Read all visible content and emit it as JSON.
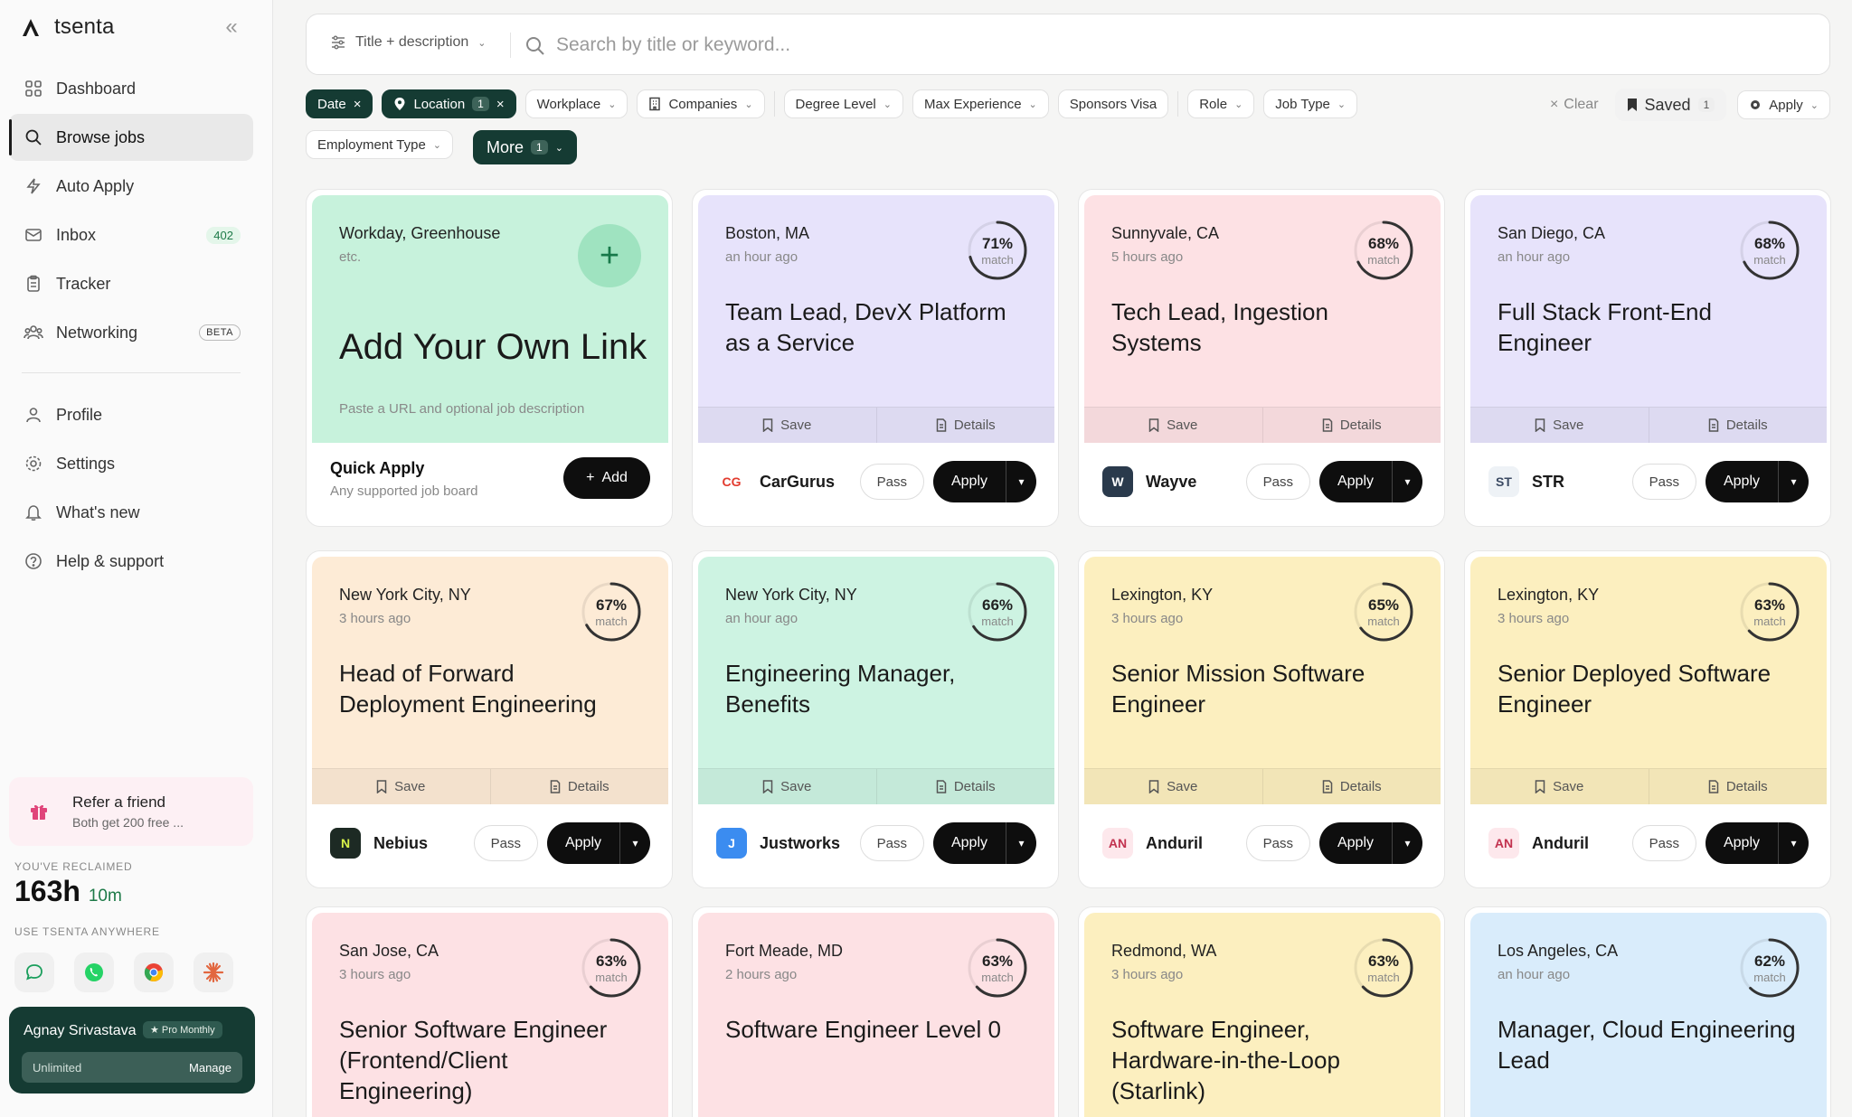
{
  "brand": {
    "name": "tsenta"
  },
  "nav": {
    "items": [
      {
        "label": "Dashboard"
      },
      {
        "label": "Browse jobs"
      },
      {
        "label": "Auto Apply"
      },
      {
        "label": "Inbox",
        "badge": "402"
      },
      {
        "label": "Tracker"
      },
      {
        "label": "Networking",
        "tag": "BETA"
      },
      {
        "label": "Profile"
      },
      {
        "label": "Settings"
      },
      {
        "label": "What's new"
      },
      {
        "label": "Help & support"
      }
    ]
  },
  "refer": {
    "title": "Refer a friend",
    "subtitle": "Both get 200 free ..."
  },
  "reclaimed": {
    "label": "YOU'VE RECLAIMED",
    "hours": "163h",
    "minutes": "10m"
  },
  "anywhere": {
    "label": "USE TSENTA ANYWHERE"
  },
  "user": {
    "name": "Agnay Srivastava",
    "plan": "Pro Monthly",
    "usage": "Unlimited",
    "manage": "Manage"
  },
  "search": {
    "mode": "Title + description",
    "placeholder": "Search by title or keyword..."
  },
  "filters": {
    "date": "Date",
    "location": "Location",
    "location_count": "1",
    "workplace": "Workplace",
    "companies": "Companies",
    "degree": "Degree Level",
    "experience": "Max Experience",
    "visa": "Sponsors Visa",
    "role": "Role",
    "jobtype": "Job Type",
    "employment": "Employment Type",
    "more": "More",
    "more_count": "1",
    "clear": "Clear",
    "saved": "Saved",
    "saved_count": "1",
    "apply": "Apply"
  },
  "quick_add": {
    "sources": "Workday, Greenhouse",
    "etc": "etc.",
    "title": "Add Your Own Link",
    "hint": "Paste a URL and optional job description",
    "qa_title": "Quick Apply",
    "qa_sub": "Any supported job board",
    "add": "Add"
  },
  "labels": {
    "save": "Save",
    "details": "Details",
    "pass": "Pass",
    "apply": "Apply",
    "match": "match"
  },
  "jobs": [
    {
      "location": "Boston, MA",
      "posted": "an hour ago",
      "match": "71%",
      "match_value": 0.71,
      "title": "Team Lead, DevX Platform as a Service",
      "company": "CarGurus",
      "logo": "CG",
      "bg": "#e7e3fb",
      "logo_bg": "#ffffff",
      "logo_fg": "#e23b2e"
    },
    {
      "location": "Sunnyvale, CA",
      "posted": "5 hours ago",
      "match": "68%",
      "match_value": 0.68,
      "title": "Tech Lead, Ingestion Systems",
      "company": "Wayve",
      "logo": "W",
      "bg": "#fde1e4",
      "logo_bg": "#2a3a4c",
      "logo_fg": "#ffffff"
    },
    {
      "location": "San Diego, CA",
      "posted": "an hour ago",
      "match": "68%",
      "match_value": 0.68,
      "title": "Full Stack Front-End Engineer",
      "company": "STR",
      "logo": "ST",
      "bg": "#e7e3fb",
      "logo_bg": "#eef2f6",
      "logo_fg": "#3b4a63"
    },
    {
      "location": "New York City, NY",
      "posted": "3 hours ago",
      "match": "67%",
      "match_value": 0.67,
      "title": "Head of Forward Deployment Engineering",
      "company": "Nebius",
      "logo": "N",
      "bg": "#fdebd6",
      "logo_bg": "#1d2a24",
      "logo_fg": "#d8f24a"
    },
    {
      "location": "New York City, NY",
      "posted": "an hour ago",
      "match": "66%",
      "match_value": 0.66,
      "title": "Engineering Manager, Benefits",
      "company": "Justworks",
      "logo": "J",
      "bg": "#cdf3e2",
      "logo_bg": "#3b8cf0",
      "logo_fg": "#ffffff"
    },
    {
      "location": "Lexington, KY",
      "posted": "3 hours ago",
      "match": "65%",
      "match_value": 0.65,
      "title": "Senior Mission Software Engineer",
      "company": "Anduril",
      "logo": "AN",
      "bg": "#fcefbf",
      "logo_bg": "#fde8ec",
      "logo_fg": "#c2324f"
    },
    {
      "location": "Lexington, KY",
      "posted": "3 hours ago",
      "match": "63%",
      "match_value": 0.63,
      "title": "Senior Deployed Software Engineer",
      "company": "Anduril",
      "logo": "AN",
      "bg": "#fcefbf",
      "logo_bg": "#fde8ec",
      "logo_fg": "#c2324f"
    },
    {
      "location": "San Jose, CA",
      "posted": "3 hours ago",
      "match": "63%",
      "match_value": 0.63,
      "title": "Senior Software Engineer (Frontend/Client Engineering)",
      "company": "",
      "logo": "",
      "bg": "#fde1e4",
      "logo_bg": "#ffffff",
      "logo_fg": "#000000"
    },
    {
      "location": "Fort Meade, MD",
      "posted": "2 hours ago",
      "match": "63%",
      "match_value": 0.63,
      "title": "Software Engineer Level 0",
      "company": "",
      "logo": "",
      "bg": "#fde1e4",
      "logo_bg": "#ffffff",
      "logo_fg": "#000000"
    },
    {
      "location": "Redmond, WA",
      "posted": "3 hours ago",
      "match": "63%",
      "match_value": 0.63,
      "title": "Software Engineer, Hardware-in-the-Loop (Starlink)",
      "company": "",
      "logo": "",
      "bg": "#fcefbf",
      "logo_bg": "#ffffff",
      "logo_fg": "#000000"
    },
    {
      "location": "Los Angeles, CA",
      "posted": "an hour ago",
      "match": "62%",
      "match_value": 0.62,
      "title": "Manager, Cloud Engineering Lead",
      "company": "",
      "logo": "",
      "bg": "#d9ecfb",
      "logo_bg": "#ffffff",
      "logo_fg": "#000000"
    }
  ]
}
